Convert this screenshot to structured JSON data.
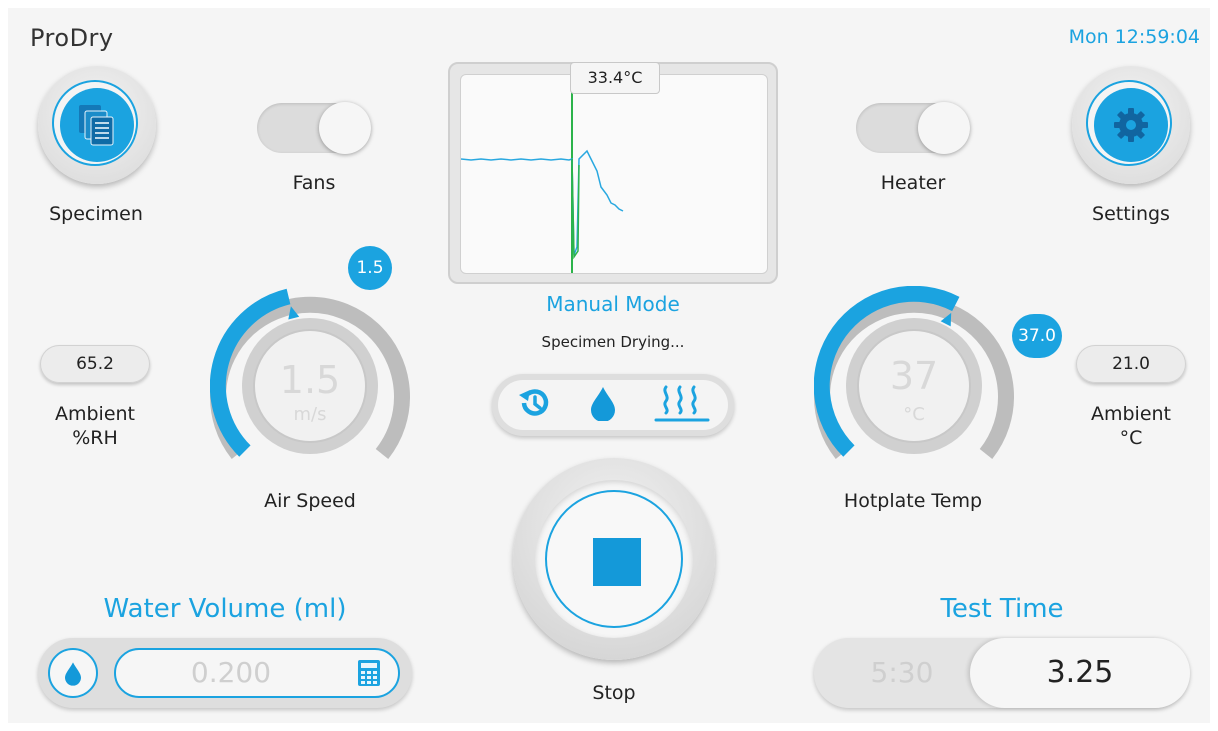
{
  "app": {
    "title": "ProDry",
    "clock": "Mon 12:59:04"
  },
  "specimen": {
    "label": "Specimen",
    "icon": "documents-icon"
  },
  "settings": {
    "label": "Settings",
    "icon": "gear-icon"
  },
  "fans": {
    "label": "Fans",
    "state": "on"
  },
  "heater": {
    "label": "Heater",
    "state": "on"
  },
  "graph": {
    "readout": "33.4°C"
  },
  "mode": {
    "label": "Manual Mode",
    "status": "Specimen Drying..."
  },
  "mode_icons": [
    "timer-reset-icon",
    "water-drop-icon",
    "heat-waves-icon"
  ],
  "ambient_rh": {
    "value": "65.2",
    "label_line1": "Ambient",
    "label_line2": "%RH"
  },
  "ambient_c": {
    "value": "21.0",
    "label_line1": "Ambient",
    "label_line2": "°C"
  },
  "air_speed": {
    "label": "Air Speed",
    "value": "1.5",
    "unit": "m/s",
    "setpoint": "1.5",
    "fraction": 0.45
  },
  "hotplate": {
    "label": "Hotplate Temp",
    "value": "37",
    "unit": "°C",
    "setpoint": "37.0",
    "fraction": 0.6
  },
  "stop": {
    "label": "Stop"
  },
  "water_volume": {
    "title": "Water Volume (ml)",
    "value": "0.200"
  },
  "test_time": {
    "title": "Test Time",
    "set_value": "5:30",
    "elapsed": "3.25"
  },
  "colors": {
    "accent": "#1ba3e0",
    "background": "#f5f5f5",
    "trace_blue": "#29a8e0",
    "trace_green": "#2cb34a"
  }
}
